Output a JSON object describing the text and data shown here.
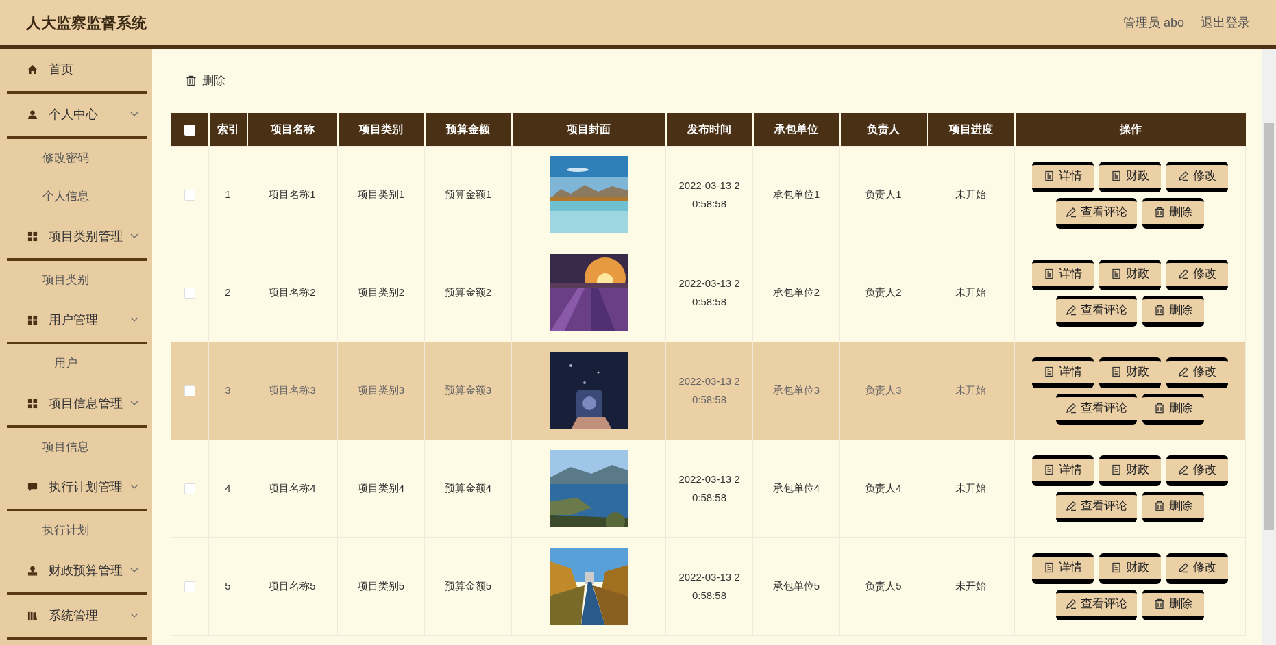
{
  "header": {
    "title": "人大监察监督系统",
    "user_label": "管理员 abo",
    "logout": "退出登录"
  },
  "sidebar": {
    "items": [
      {
        "label": "首页",
        "expandable": false
      },
      {
        "label": "个人中心",
        "expandable": true,
        "children": [
          {
            "label": "修改密码"
          },
          {
            "label": "个人信息"
          }
        ]
      },
      {
        "label": "项目类别管理",
        "expandable": true,
        "children": [
          {
            "label": "项目类别"
          }
        ]
      },
      {
        "label": "用户管理",
        "expandable": true,
        "children": [
          {
            "label": "用户"
          }
        ]
      },
      {
        "label": "项目信息管理",
        "expandable": true,
        "children": [
          {
            "label": "项目信息"
          }
        ]
      },
      {
        "label": "执行计划管理",
        "expandable": true,
        "children": [
          {
            "label": "执行计划"
          }
        ]
      },
      {
        "label": "财政预算管理",
        "expandable": true
      },
      {
        "label": "系统管理",
        "expandable": true
      }
    ]
  },
  "toolbar": {
    "delete_button": "删除"
  },
  "table": {
    "select_all": {
      "checked": false
    },
    "columns": [
      "索引",
      "项目名称",
      "项目类别",
      "预算金额",
      "项目封面",
      "发布时间",
      "承包单位",
      "负责人",
      "项目进度",
      "操作"
    ],
    "rows": [
      {
        "checked": false,
        "highlighted": false,
        "index": "1",
        "name": "项目名称1",
        "type": "项目类别1",
        "budget": "预算金额1",
        "time": "2022-03-13 20:58:58",
        "unit": "承包单位1",
        "person": "负责人1",
        "progress": "未开始",
        "actions": [
          "详情",
          "财政",
          "修改",
          "查看评论",
          "删除"
        ]
      },
      {
        "checked": false,
        "highlighted": false,
        "index": "2",
        "name": "项目名称2",
        "type": "项目类别2",
        "budget": "预算金额2",
        "time": "2022-03-13 20:58:58",
        "unit": "承包单位2",
        "person": "负责人2",
        "progress": "未开始",
        "actions": [
          "详情",
          "财政",
          "修改",
          "查看评论",
          "删除"
        ]
      },
      {
        "checked": false,
        "highlighted": true,
        "index": "3",
        "name": "项目名称3",
        "type": "项目类别3",
        "budget": "预算金额3",
        "time": "2022-03-13 20:58:58",
        "unit": "承包单位3",
        "person": "负责人3",
        "progress": "未开始",
        "actions": [
          "详情",
          "财政",
          "修改",
          "查看评论",
          "删除"
        ]
      },
      {
        "checked": false,
        "highlighted": false,
        "index": "4",
        "name": "项目名称4",
        "type": "项目类别4",
        "budget": "预算金额4",
        "time": "2022-03-13 20:58:58",
        "unit": "承包单位4",
        "person": "负责人4",
        "progress": "未开始",
        "actions": [
          "详情",
          "财政",
          "修改",
          "查看评论",
          "删除"
        ]
      },
      {
        "checked": false,
        "highlighted": false,
        "index": "5",
        "name": "项目名称5",
        "type": "项目类别5",
        "budget": "预算金额5",
        "time": "2022-03-13 20:58:58",
        "unit": "承包单位5",
        "person": "负责人5",
        "progress": "未开始",
        "actions": [
          "详情",
          "财政",
          "修改",
          "查看评论",
          "删除"
        ]
      }
    ]
  }
}
